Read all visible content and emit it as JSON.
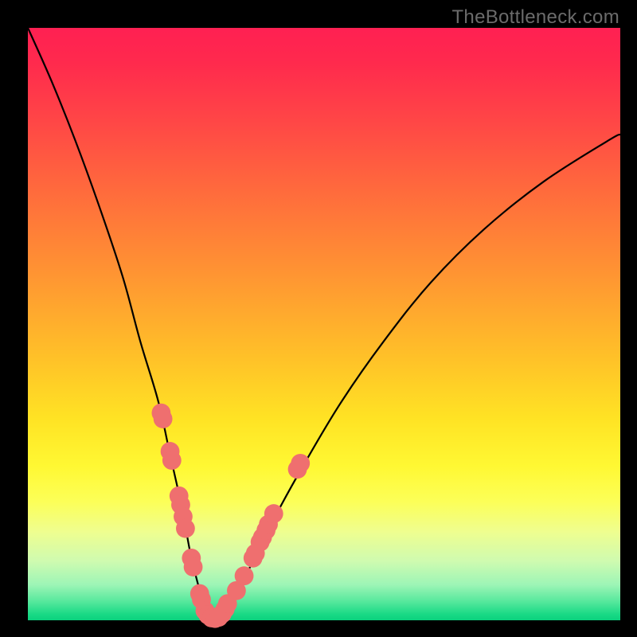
{
  "watermark": "TheBottleneck.com",
  "chart_data": {
    "type": "line",
    "title": "",
    "xlabel": "",
    "ylabel": "",
    "xlim": [
      0,
      100
    ],
    "ylim": [
      0,
      100
    ],
    "grid": false,
    "legend": false,
    "series": [
      {
        "name": "bottleneck-curve",
        "color": "#000000",
        "x": [
          0,
          4,
          8,
          12,
          16,
          19,
          22,
          24,
          26,
          27.5,
          29,
          30,
          31,
          32.5,
          35,
          38,
          42,
          47,
          53,
          60,
          68,
          77,
          87,
          98,
          100
        ],
        "y": [
          100,
          91,
          81,
          70,
          58,
          47,
          37,
          28,
          19,
          11,
          5,
          1,
          0,
          0.5,
          4,
          10,
          18,
          27,
          37,
          47,
          57,
          66,
          74,
          81,
          82
        ]
      }
    ],
    "points": {
      "name": "highlight-points",
      "color": "#ef6f6f",
      "radius": 1.6,
      "xy": [
        [
          22.5,
          35
        ],
        [
          22.8,
          34
        ],
        [
          24.0,
          28.5
        ],
        [
          24.3,
          27
        ],
        [
          25.5,
          21
        ],
        [
          25.8,
          19.5
        ],
        [
          26.2,
          17.5
        ],
        [
          26.6,
          15.5
        ],
        [
          27.6,
          10.5
        ],
        [
          27.9,
          9
        ],
        [
          29.0,
          4.5
        ],
        [
          29.3,
          3.5
        ],
        [
          29.9,
          1.6
        ],
        [
          30.4,
          0.9
        ],
        [
          31.0,
          0.4
        ],
        [
          31.6,
          0.3
        ],
        [
          32.2,
          0.5
        ],
        [
          32.8,
          1.1
        ],
        [
          33.3,
          1.9
        ],
        [
          33.7,
          2.8
        ],
        [
          35.2,
          5.0
        ],
        [
          36.5,
          7.5
        ],
        [
          38.0,
          10.5
        ],
        [
          38.4,
          11.3
        ],
        [
          39.2,
          13.2
        ],
        [
          39.6,
          14.0
        ],
        [
          40.2,
          15.2
        ],
        [
          40.6,
          16.2
        ],
        [
          41.5,
          18.0
        ],
        [
          45.5,
          25.5
        ],
        [
          46.0,
          26.5
        ]
      ]
    }
  }
}
